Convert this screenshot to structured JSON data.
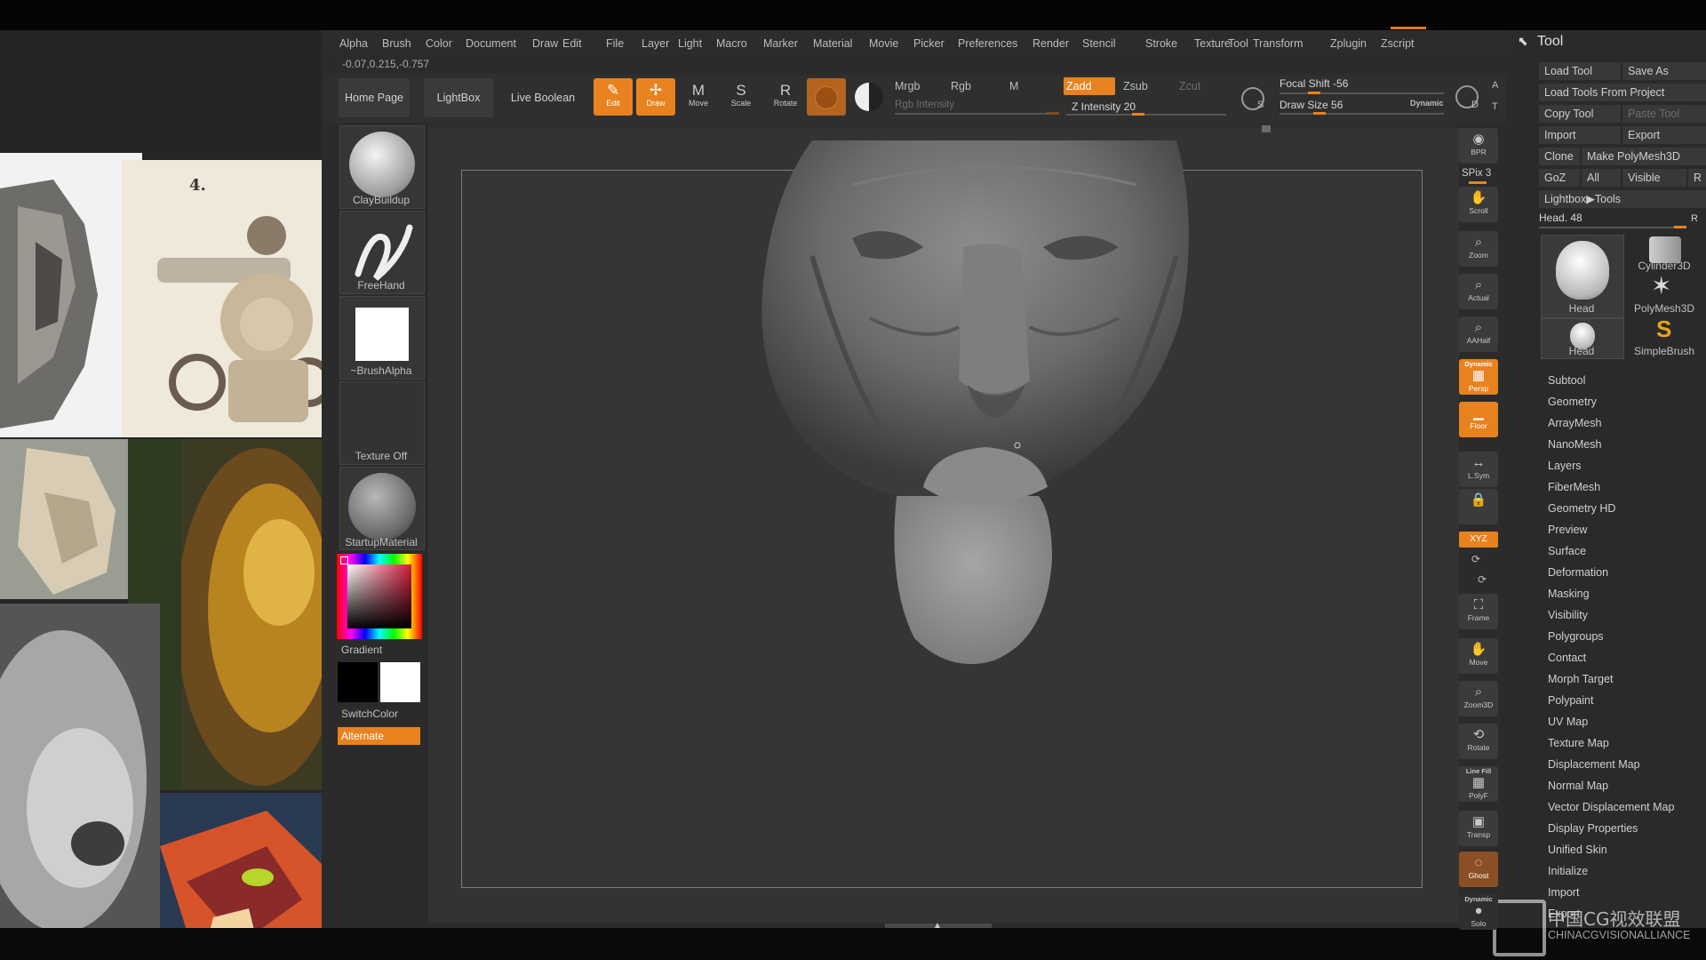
{
  "menu": [
    "Alpha",
    "Brush",
    "Color",
    "Document",
    "Draw",
    "Edit",
    "File",
    "Layer",
    "Light",
    "Macro",
    "Marker",
    "Material",
    "Movie",
    "Picker",
    "Preferences",
    "Render",
    "Stencil",
    "Stroke",
    "Texture",
    "Tool",
    "Transform",
    "Zplugin",
    "Zscript"
  ],
  "coords": "-0.07,0.215,-0.757",
  "nav": {
    "home": "Home Page",
    "lightbox": "LightBox",
    "live_boolean": "Live Boolean"
  },
  "transform_buttons": [
    {
      "label": "Edit",
      "icon": "✎",
      "active": true
    },
    {
      "label": "Draw",
      "icon": "✢",
      "active": true
    },
    {
      "label": "Move",
      "icon": "M",
      "active": false
    },
    {
      "label": "Scale",
      "icon": "S",
      "active": false
    },
    {
      "label": "Rotate",
      "icon": "R",
      "active": false
    }
  ],
  "modes": {
    "mrgb": "Mrgb",
    "rgb": "Rgb",
    "m": "M",
    "rgb_intensity": "Rgb Intensity",
    "zadd": "Zadd",
    "zsub": "Zsub",
    "zcut": "Zcut",
    "z_intensity": "Z Intensity 20",
    "focal_shift": "Focal Shift -56",
    "draw_size": "Draw Size 56",
    "dynamic": "Dynamic"
  },
  "mini_labels": {
    "s": "S",
    "d": "D",
    "a": "A",
    "t": "T"
  },
  "left_tray": {
    "brush": "ClayBuildup",
    "stroke": "FreeHand",
    "alpha": "~BrushAlpha",
    "texture": "Texture Off",
    "material": "StartupMaterial",
    "gradient": "Gradient",
    "switchcolor": "SwitchColor",
    "alternate": "Alternate"
  },
  "ref_label": "4.",
  "right_shelf": [
    {
      "label": "BPR",
      "icon": "◉"
    },
    {
      "label": "Scroll",
      "icon": "✋"
    },
    {
      "label": "Zoom",
      "icon": "⌕"
    },
    {
      "label": "Actual",
      "icon": "⌕"
    },
    {
      "label": "AAHalf",
      "icon": "⌕"
    },
    {
      "label": "Persp",
      "icon": "▦",
      "active": true,
      "top": "Dynamic"
    },
    {
      "label": "Floor",
      "icon": "▁",
      "active": true
    },
    {
      "label": "L.Sym",
      "icon": "↔"
    },
    {
      "label": "",
      "icon": "🔒"
    },
    {
      "label": "Frame",
      "icon": "⛶"
    },
    {
      "label": "Move",
      "icon": "✋"
    },
    {
      "label": "Zoom3D",
      "icon": "⌕"
    },
    {
      "label": "Rotate",
      "icon": "⟲"
    },
    {
      "label": "PolyF",
      "icon": "▦",
      "top": "Line Fill"
    },
    {
      "label": "Transp",
      "icon": "▣"
    },
    {
      "label": "Ghost",
      "icon": "◌",
      "active": true
    },
    {
      "label": "Solo",
      "icon": "●",
      "top": "Dynamic"
    }
  ],
  "spix": "SPix 3",
  "xyz": "XYZ",
  "tool_palette": {
    "title": "Tool",
    "load_tool": "Load Tool",
    "save_as": "Save As",
    "load_from_project": "Load Tools From Project",
    "copy_tool": "Copy Tool",
    "paste_tool": "Paste Tool",
    "import": "Import",
    "export": "Export",
    "clone": "Clone",
    "make_polymesh": "Make PolyMesh3D",
    "goz": "GoZ",
    "all": "All",
    "visible": "Visible",
    "r": "R",
    "lightbox_tools": "Lightbox▶Tools",
    "head_slider": "Head. 48",
    "tools": [
      {
        "name": "Head",
        "glyph": "☻"
      },
      {
        "name": "Cylinder3D",
        "glyph": "▮"
      },
      {
        "name": "PolyMesh3D",
        "glyph": "✶"
      },
      {
        "name": "Head",
        "glyph": "☻"
      },
      {
        "name": "SimpleBrush",
        "glyph": "S"
      }
    ],
    "subpalettes": [
      "Subtool",
      "Geometry",
      "ArrayMesh",
      "NanoMesh",
      "Layers",
      "FiberMesh",
      "Geometry HD",
      "Preview",
      "Surface",
      "Deformation",
      "Masking",
      "Visibility",
      "Polygroups",
      "Contact",
      "Morph Target",
      "Polypaint",
      "UV Map",
      "Texture Map",
      "Displacement Map",
      "Normal Map",
      "Vector Displacement Map",
      "Display Properties",
      "Unified Skin",
      "Initialize",
      "Import",
      "Export"
    ]
  },
  "watermark": {
    "cn": "中国CG视效联盟",
    "en": "CHINACGVISIONALLIANCE"
  },
  "colors": {
    "accent": "#e8821f",
    "bg": "#2b2b2b",
    "canvas": "#333333"
  }
}
